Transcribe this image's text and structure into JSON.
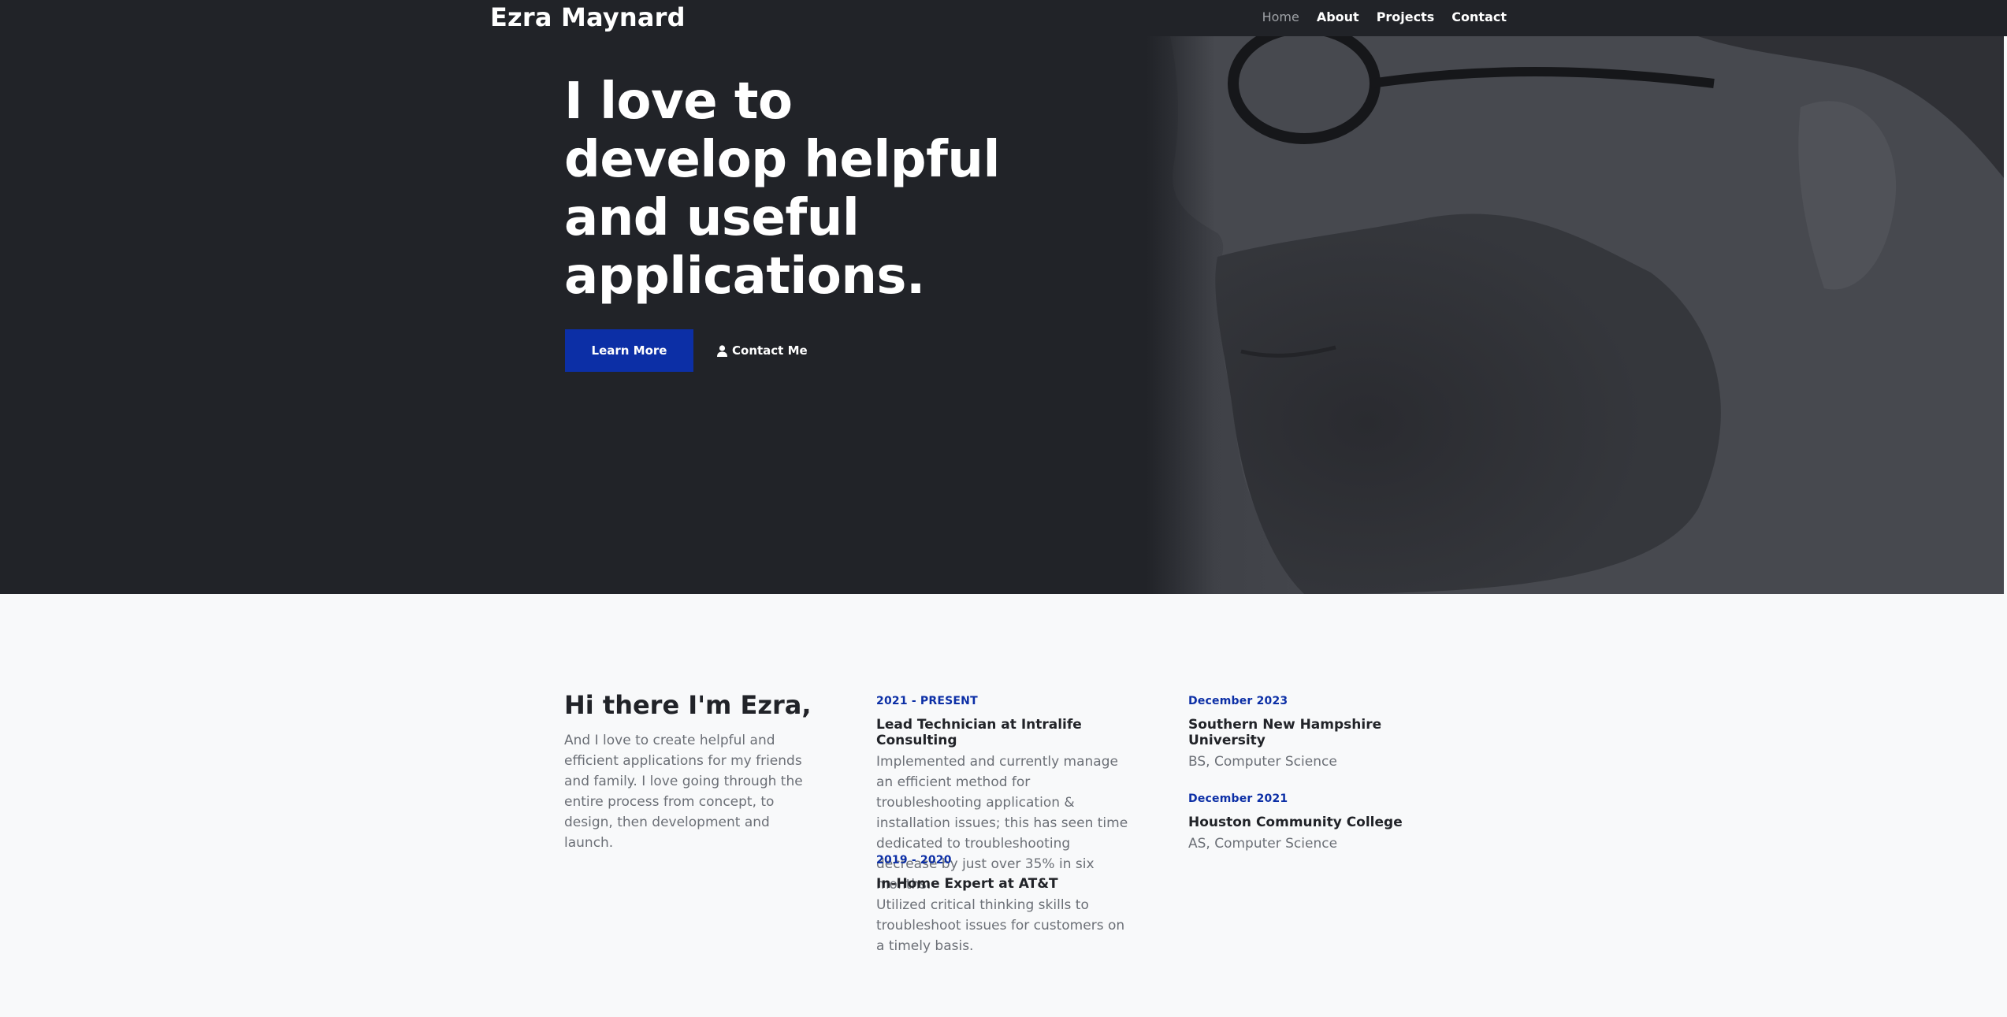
{
  "nav": {
    "brand": "Ezra Maynard",
    "links": [
      "Home",
      "About",
      "Projects",
      "Contact"
    ]
  },
  "hero": {
    "title": "I love to develop helpful and useful applications.",
    "primary_button": "Learn More",
    "secondary_button": "Contact Me",
    "secondary_icon": "user-icon"
  },
  "about": {
    "title": "Hi there I'm Ezra,",
    "text": "And I love to create helpful and efficient applications for my friends and family. I love going through the entire process from concept, to design, then development and launch."
  },
  "experience": [
    {
      "date": "2021 - PRESENT",
      "title": "Lead Technician at Intralife Consulting",
      "desc": "Implemented and currently manage an efficient method for troubleshooting application & installation issues; this has seen time dedicated to troubleshooting decrease by just over 35% in six months."
    },
    {
      "date": "2019 - 2020",
      "title": "In-Home Expert at AT&T",
      "desc": "Utilized critical thinking skills to troubleshoot issues for customers on a timely basis."
    }
  ],
  "education": [
    {
      "date": "December 2023",
      "title": "Southern New Hampshire University",
      "desc": "BS, Computer Science"
    },
    {
      "date": "December 2021",
      "title": "Houston Community College",
      "desc": "AS, Computer Science"
    }
  ],
  "colors": {
    "dark": "#212328",
    "accent": "#0c2fa6",
    "light_bg": "#f8f9fa",
    "muted_text": "#6b6f76"
  }
}
